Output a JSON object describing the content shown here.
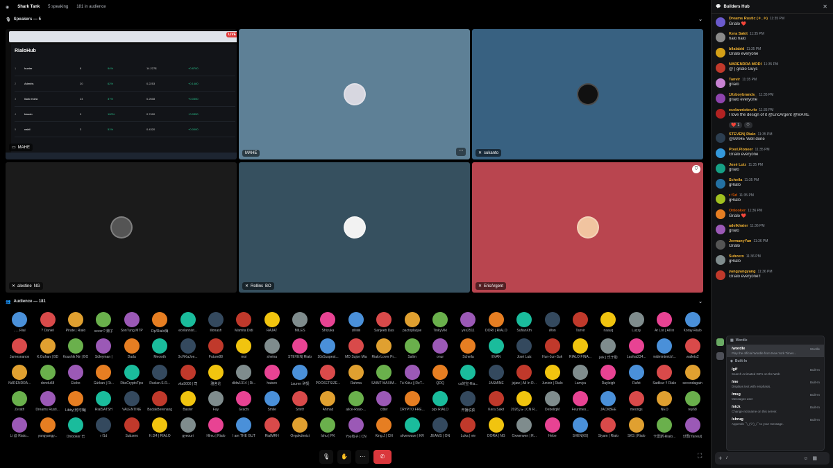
{
  "topbar": {
    "title": "Shark Tank",
    "speaking": "5 speaking",
    "audience": "181 in audience"
  },
  "speakers": {
    "header": "Speakers — 5",
    "tiles": [
      {
        "name": "MAHE",
        "color": "#2c2c2c",
        "type": "screenshare"
      },
      {
        "name": "MAHE",
        "color": "#5e8096",
        "badge": ""
      },
      {
        "name": "sukanto",
        "color": "#386181",
        "badge": ""
      },
      {
        "name": "alextine",
        "color": "#1b1b1b",
        "badge": "NG"
      },
      {
        "name": "Rollins",
        "color": "#36505f",
        "badge": "BO"
      },
      {
        "name": "EricArgent",
        "color": "#b9454f",
        "badge": ""
      }
    ],
    "share": {
      "app": "RialoHub",
      "tabs": [
        "RialoHub",
        "WhiteList"
      ],
      "rows": [
        {
          "rank": "1",
          "name": "hunter",
          "pts": "8",
          "pct": "94%",
          "vol": "14.227$",
          "chg": "+0.8700"
        },
        {
          "rank": "2",
          "name": "Admiris",
          "pts": "20",
          "pct": "62%",
          "vol": "0.2253",
          "chg": "+0.1480"
        },
        {
          "rank": "3",
          "name": "lluck moira",
          "pts": "24",
          "pct": "37%",
          "vol": "0.2608",
          "chg": "+0.0350"
        },
        {
          "rank": "4",
          "name": "kiosob",
          "pts": "0",
          "pct": "100%",
          "vol": "0.7400",
          "chg": "+0.0350"
        },
        {
          "rank": "5",
          "name": "nabil",
          "pts": "3",
          "pct": "51%",
          "vol": "0.4320",
          "chg": "+0.0000"
        }
      ]
    }
  },
  "audience": {
    "header": "Audience — 181",
    "members": [
      "......Rial",
      "? Daniel",
      "Pirate | Rialo",
      "seven? 瓣子",
      "SonTung.MTP",
      "Dp/Rialo嗨",
      "ecelannist...",
      "illonash",
      "Mamita Didi",
      "RAJAT",
      "MILES",
      "Shizuka",
      "zilliiiiii",
      "Sanjeeb Das",
      "pactoplaque",
      "TinkyViki",
      "yes2511",
      "DORI | RIALO",
      "SufianXfn",
      "Won",
      "Tanvir",
      "naauq",
      "Luzzy",
      "Ar Lor | All in",
      "Koray-Rialo",
      "Jamesnanox",
      "K.Gufran | BD",
      "Koushik Nir | BO",
      "Süleyman |",
      "Dada",
      "Meowth",
      "0xViKaJoe...",
      "Future88",
      "moi",
      "sheina",
      "STEVEN| Rialo",
      "10xSuspest...",
      "MD Sujon Mia",
      "Rialo Lover Pr...",
      "Salim",
      "onur",
      "Scheila",
      "EVAN",
      "José Luiz",
      "Hun-Jun-Suk",
      "RIALO FINA...",
      "jiek | 乐于助",
      "Laohai234...",
      "midmintmick!...",
      "wallets2",
      "NARENDRA...",
      "dondu58",
      "Etebo",
      "Gürkan | Ri...",
      "RitaCryptoTips",
      "Ruslan.S-R...",
      "vita5000 | 司",
      "雅舍论",
      "dldw1314 | Ri...",
      "haisen",
      "Lauren 碎煲",
      "POCKETSIZE...",
      "Rahma",
      "SAINT MAXIM...",
      "Tú Kiều || ReT...",
      "QDQ",
      "cx的宝-Ria...",
      "JASMINE",
      "jejaw | All In R...",
      "Junioir | Rialo",
      "Lamiya",
      "Rayleigh",
      "Rufst",
      "Sadikur !! Rialo",
      "secondagain",
      "Zerath",
      "Dreams Rusti...",
      "Libby(何可嗨)",
      "RialSATSH",
      "VALENTINE",
      "BadakBerenang",
      "Baster",
      "Fay",
      "Grachi",
      "Smile",
      "Smith",
      "Ahmad",
      "alice-Rialo-...",
      "citter",
      "CRYPTO FRE...",
      "pipi RIALO",
      "开播说获",
      "Kera Sakit",
      "2026جاز | CN R...",
      "DebeliqM",
      "Feurimes...",
      "JACKBEE",
      "meongs",
      "NEO",
      "rey68",
      "Li @ Rialo...",
      "yangyangy...",
      "Onlooker 已",
      "r f1d",
      "Subzero",
      "H.I24 | RIALO",
      "gyeouri",
      "Hlmu | Rialo",
      "I am THE GUT",
      "RialMRH",
      "Ovgokdenizi",
      "Ishu | PK",
      "You有子 | CN",
      "King.J | CN",
      "silverwave | KR",
      "JEAMS | ON",
      "Luka | vie",
      "DORA | NG",
      "Oxwerwen | R...",
      "Hebe",
      "SHEN(69)",
      "Siyam | Rialo",
      "SKS | Rialo",
      "卡雷斯-Rialo...",
      "안졸(Yaneul)"
    ]
  },
  "callbar": {
    "mute": "mic-off",
    "hand": "raise",
    "more": "more",
    "leave": "leave"
  },
  "chat": {
    "title": "Builders Hub",
    "messages": [
      {
        "user": "Dreams Rustic (✧_✧)",
        "time": "11:35 PM",
        "text": "Grialo ❤️",
        "ucolor": "#f0b232",
        "pic": "#6a5acd"
      },
      {
        "user": "Kera Sakit",
        "time": "11:35 PM",
        "text": "halo halo",
        "ucolor": "#f0b232",
        "pic": "#8a8a8a"
      },
      {
        "user": "bilalabid",
        "time": "11:35 PM",
        "text": "Grialo everyone",
        "ucolor": "#f0b232",
        "pic": "#d4a017"
      },
      {
        "user": "NARENDRA MODI",
        "time": "11:35 PM",
        "text": "@ | grialo Guys",
        "ucolor": "#f0b232",
        "pic": "#c0392b"
      },
      {
        "user": "Tanvir",
        "time": "11:35 PM",
        "text": "grialo",
        "ucolor": "#f0b232",
        "pic": "#c882d3"
      },
      {
        "user": "10xboybrands_",
        "time": "11:35 PM",
        "text": "grialo everyone",
        "ucolor": "#f0b232",
        "pic": "#8e44ad"
      },
      {
        "user": "ecelannister.rlo",
        "time": "11:35 PM",
        "text": "I love the design of it @EricArgent @MAHE",
        "ucolor": "#f0b232",
        "pic": "#b22222"
      },
      {
        "user": "STEVEN| Rialo",
        "time": "11:35 PM",
        "text": "@MAHE Well done",
        "ucolor": "#f0b232",
        "pic": "#2c3e50"
      },
      {
        "user": "Pixel.Pioneer",
        "time": "11:35 PM",
        "text": "Grialo everyone",
        "ucolor": "#f0b232",
        "pic": "#3498db"
      },
      {
        "user": "José Luiz",
        "time": "11:35 PM",
        "text": "grialo",
        "ucolor": "#f0b232",
        "pic": "#16a085"
      },
      {
        "user": "Scheila",
        "time": "11:35 PM",
        "text": "gRialo",
        "ucolor": "#f0b232",
        "pic": "#2471a3"
      },
      {
        "user": "r f1d",
        "time": "11:35 PM",
        "text": "gRialo",
        "ucolor": "#d35400",
        "pic": "#a0c020"
      },
      {
        "user": "Onlooker",
        "time": "11:36 PM",
        "text": "Grialo ❤️",
        "ucolor": "#d35400",
        "pic": "#e67e22"
      },
      {
        "user": "adelkhater",
        "time": "11:36 PM",
        "text": "grialo",
        "ucolor": "#f0b232",
        "pic": "#9b59b6"
      },
      {
        "user": "JermanyYan",
        "time": "11:36 PM",
        "text": "Grialo",
        "ucolor": "#f0b232",
        "pic": "#555"
      },
      {
        "user": "Subzero",
        "time": "11:36 PM",
        "text": "gRialo",
        "ucolor": "#f0b232",
        "pic": "#7f8c8d"
      },
      {
        "user": "yangyangyang",
        "time": "11:36 PM",
        "text": "Grialo everyone!!",
        "ucolor": "#f0b232",
        "pic": "#c0392b"
      }
    ],
    "reactions": [
      {
        "emoji": "❤️",
        "count": "1"
      },
      {
        "emoji": "☺",
        "count": ""
      }
    ],
    "commands": {
      "apps_label": "Wordle",
      "apps": [
        {
          "cmd": "/wordle",
          "desc": "Play the official Wordle from New York Times...",
          "src": "Wordle"
        }
      ],
      "builtin_label": "Built-In",
      "builtin": [
        {
          "cmd": "/gif",
          "desc": "Search Animated GIFs on the Web",
          "src": "Built-In"
        },
        {
          "cmd": "/me",
          "desc": "Displays text with emphasis.",
          "src": "Built-In"
        },
        {
          "cmd": "/msg",
          "desc": "Messages user",
          "src": "Built-In"
        },
        {
          "cmd": "/nick",
          "desc": "Change nickname on this server.",
          "src": "Built-In"
        },
        {
          "cmd": "/shrug",
          "desc": "Appends ¯\\_(ツ)_/¯ to your message.",
          "src": "Built-In"
        }
      ]
    },
    "composer": {
      "value": "/",
      "placeholder": ""
    }
  }
}
